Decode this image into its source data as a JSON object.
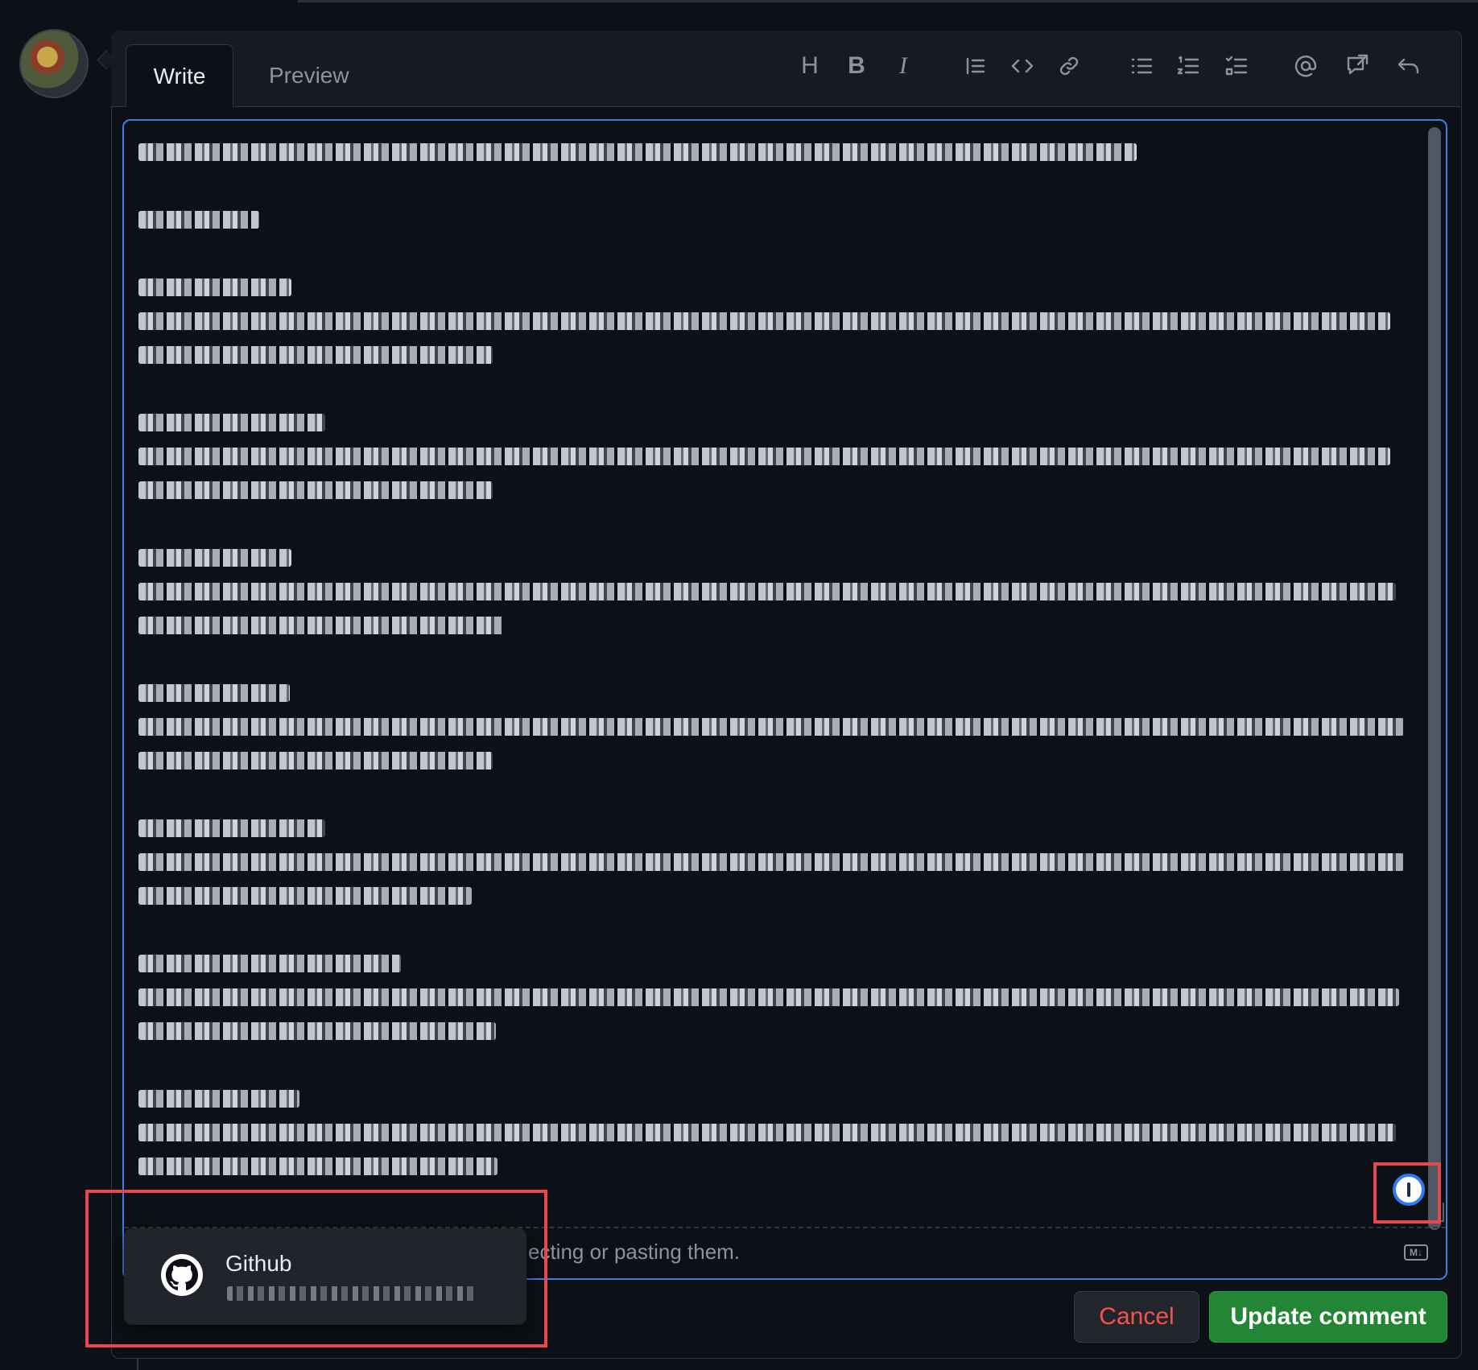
{
  "tabs": {
    "write": "Write",
    "preview": "Preview"
  },
  "toolbar": {
    "heading": "H",
    "bold": "B",
    "italic": "I",
    "icons": [
      "heading-icon",
      "bold-icon",
      "italic-icon",
      "quote-icon",
      "code-icon",
      "link-icon",
      "unordered-list-icon",
      "ordered-list-icon",
      "task-list-icon",
      "mention-icon",
      "reference-icon",
      "undo-icon"
    ]
  },
  "editor": {
    "footer_hint": "ecting or pasting them.",
    "markdown_badge": "M↓"
  },
  "autofill_popup": {
    "title": "Github"
  },
  "buttons": {
    "cancel": "Cancel",
    "update": "Update comment"
  },
  "colors": {
    "background": "#0d1117",
    "focus_border": "#3b7ee8",
    "primary_button": "#238636",
    "danger_text": "#f85149",
    "highlight": "#e5484d"
  }
}
